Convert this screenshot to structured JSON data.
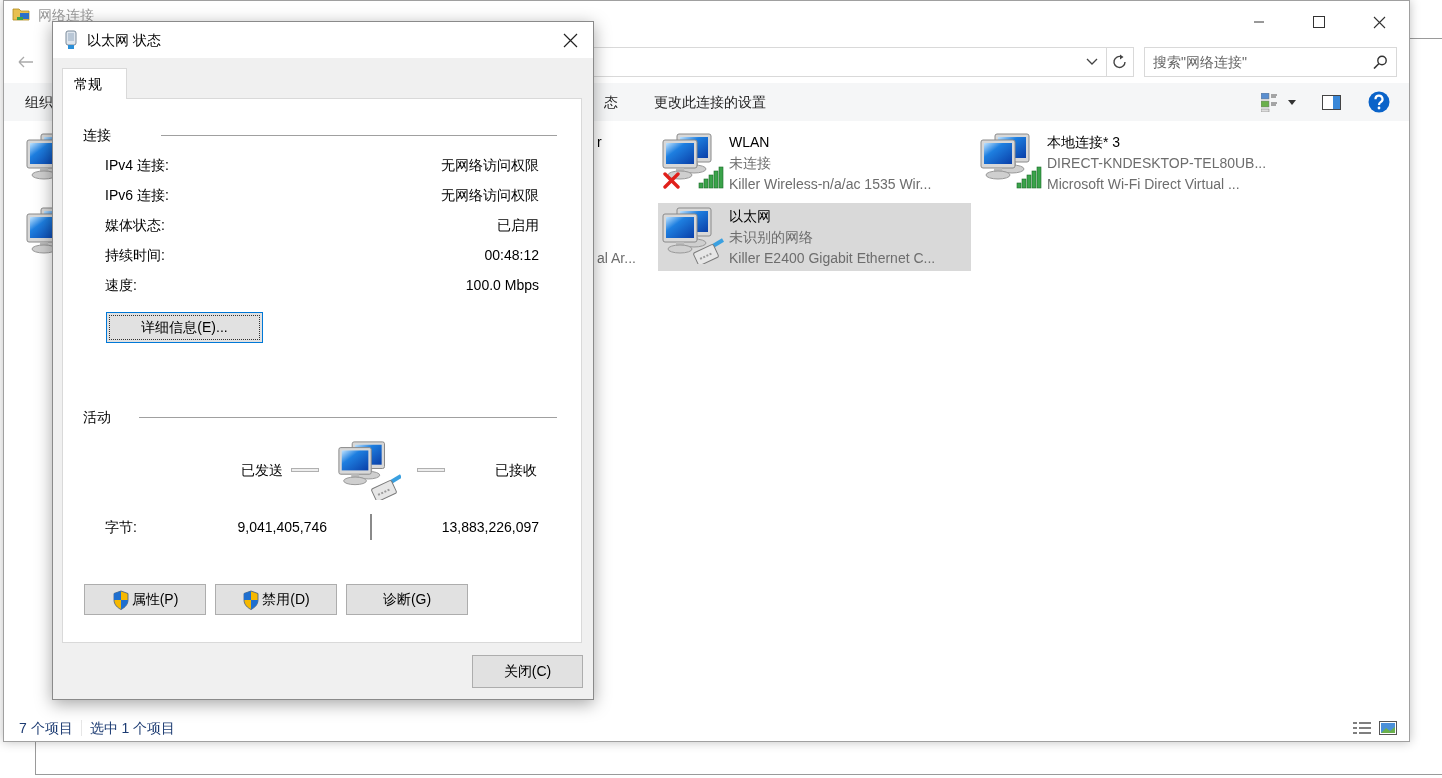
{
  "explorer": {
    "title": "网络连接",
    "search": {
      "placeholder": "搜索\"网络连接\""
    },
    "toolbar": [
      {
        "label": "组织"
      },
      {
        "label": "态"
      },
      {
        "label": "更改此连接的设置"
      }
    ],
    "adapters": [
      {
        "kind": "plain"
      },
      {
        "name": "r"
      },
      {
        "name": "WLAN",
        "status": "未连接",
        "device": "Killer Wireless-n/a/ac 1535 Wir...",
        "kind": "wifi",
        "disconnected": true,
        "selected": false
      },
      {
        "name": "本地连接* 3",
        "status": "DIRECT-KNDESKTOP-TEL80UB...",
        "device": "Microsoft Wi-Fi Direct Virtual ...",
        "kind": "wifi",
        "disconnected": false,
        "selected": false
      },
      {
        "kind": "plain"
      },
      {
        "device": "al Ar..."
      },
      {
        "name": "以太网",
        "status": "未识别的网络",
        "device": "Killer E2400 Gigabit Ethernet C...",
        "kind": "ethernet",
        "disconnected": false,
        "selected": true
      }
    ],
    "status_bar": {
      "count": "7 个项目",
      "selection": "选中 1 个项目"
    }
  },
  "dialog": {
    "title": "以太网 状态",
    "tabs": [
      {
        "label": "常规",
        "selected": true
      }
    ],
    "connection": {
      "heading": "连接",
      "rows": [
        {
          "label": "IPv4 连接:",
          "value": "无网络访问权限"
        },
        {
          "label": "IPv6 连接:",
          "value": "无网络访问权限"
        },
        {
          "label": "媒体状态:",
          "value": "已启用"
        },
        {
          "label": "持续时间:",
          "value": "00:48:12"
        },
        {
          "label": "速度:",
          "value": "100.0 Mbps"
        }
      ]
    },
    "details_button": "详细信息(E)...",
    "activity": {
      "heading": "活动",
      "sent_label": "已发送",
      "received_label": "已接收",
      "bytes_label": "字节:",
      "bytes_sent": "9,041,405,746",
      "bytes_received": "13,883,226,097"
    },
    "buttons": [
      {
        "label": "属性(P)",
        "shield": true
      },
      {
        "label": "禁用(D)",
        "shield": true
      },
      {
        "label": "诊断(G)",
        "shield": false
      }
    ],
    "close_button": "关闭(C)"
  }
}
